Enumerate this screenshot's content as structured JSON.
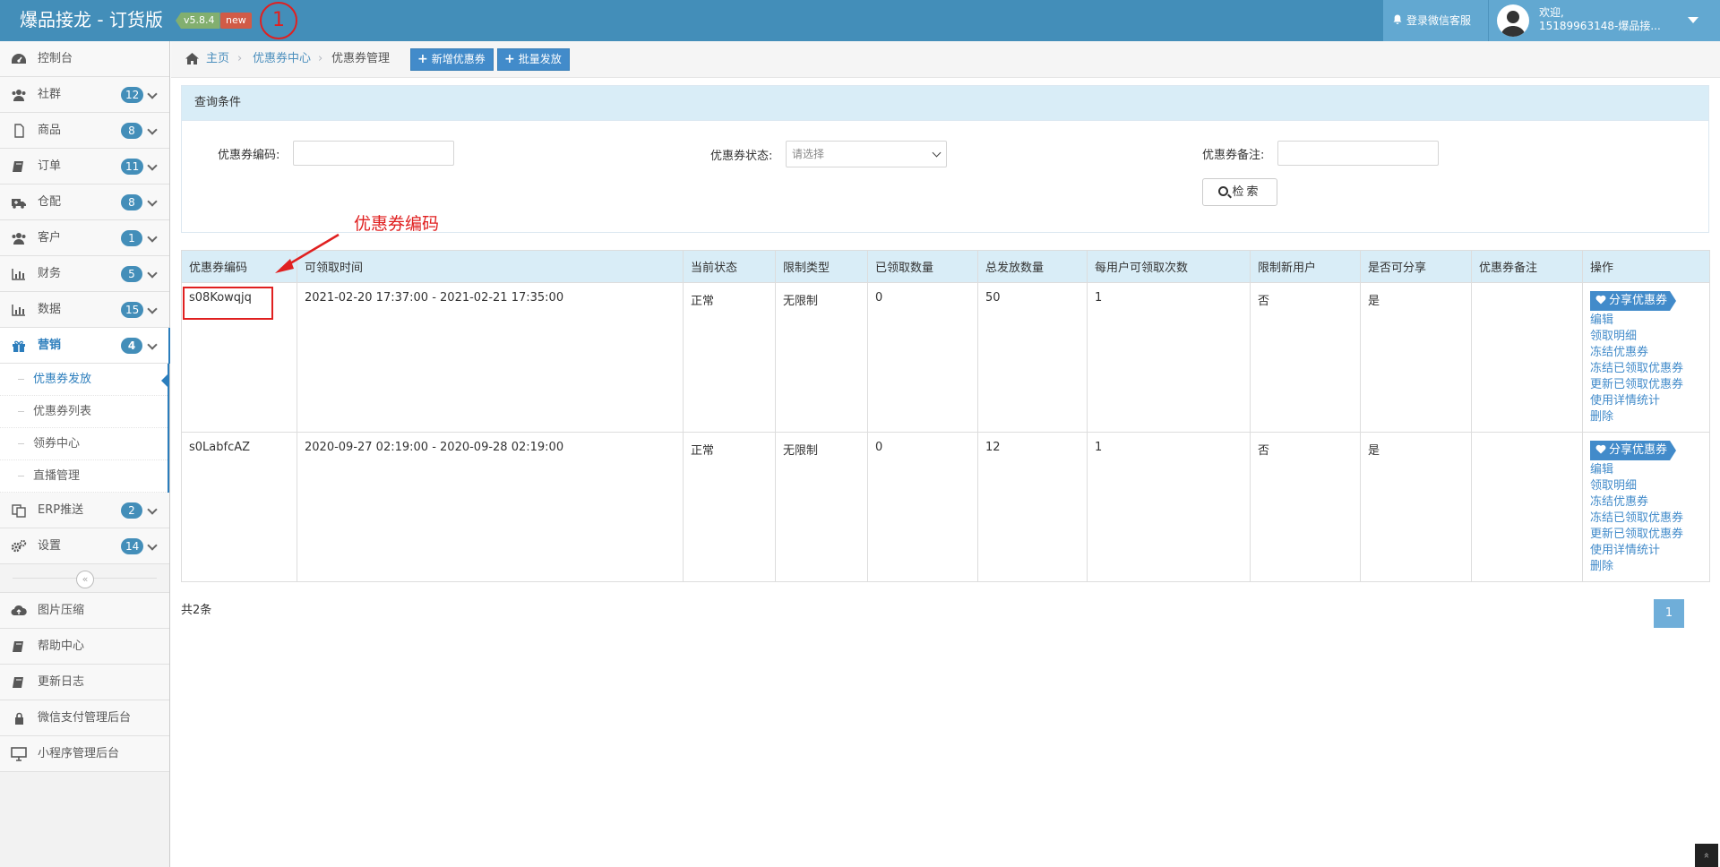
{
  "header": {
    "brand": "爆品接龙 - 订货版",
    "version": "v5.8.4",
    "new_badge": "new",
    "annotation_number": "1",
    "support_label": "登录微信客服",
    "welcome": "欢迎,",
    "user_name": "15189963148-爆品接..."
  },
  "sidebar": {
    "items": [
      {
        "label": "控制台",
        "icon": "dashboard-icon"
      },
      {
        "label": "社群",
        "count": "12",
        "icon": "users-icon"
      },
      {
        "label": "商品",
        "count": "8",
        "icon": "file-icon"
      },
      {
        "label": "订单",
        "count": "11",
        "icon": "book-icon"
      },
      {
        "label": "仓配",
        "count": "8",
        "icon": "ambulance-icon"
      },
      {
        "label": "客户",
        "count": "1",
        "icon": "users-icon"
      },
      {
        "label": "财务",
        "count": "5",
        "icon": "bar-chart-icon"
      },
      {
        "label": "数据",
        "count": "15",
        "icon": "bar-chart-icon"
      },
      {
        "label": "营销",
        "count": "4",
        "icon": "gift-icon"
      }
    ],
    "submenu": [
      "优惠券发放",
      "优惠券列表",
      "领券中心",
      "直播管理"
    ],
    "items2": [
      {
        "label": "ERP推送",
        "count": "2",
        "icon": "copy-icon"
      },
      {
        "label": "设置",
        "count": "14",
        "icon": "cogs-icon"
      }
    ],
    "collapse_glyph": "«",
    "items3": [
      {
        "label": "图片压缩",
        "icon": "cloud-upload-icon"
      },
      {
        "label": "帮助中心",
        "icon": "book-icon"
      },
      {
        "label": "更新日志",
        "icon": "book-icon"
      },
      {
        "label": "微信支付管理后台",
        "icon": "lock-icon"
      },
      {
        "label": "小程序管理后台",
        "icon": "desktop-icon"
      }
    ]
  },
  "breadcrumb": {
    "home": "主页",
    "sep": "›",
    "level1": "优惠券中心",
    "current": "优惠券管理"
  },
  "toolbar": {
    "add_coupon": "新增优惠券",
    "batch_issue": "批量发放"
  },
  "query": {
    "title": "查询条件",
    "code_label": "优惠券编码:",
    "code_value": "",
    "status_label": "优惠券状态:",
    "status_selected": "请选择",
    "remark_label": "优惠券备注:",
    "remark_value": "",
    "search_button": "检索"
  },
  "annotation": {
    "label": "优惠券编码"
  },
  "table": {
    "columns": [
      "优惠券编码",
      "可领取时间",
      "当前状态",
      "限制类型",
      "已领取数量",
      "总发放数量",
      "每用户可领取次数",
      "限制新用户",
      "是否可分享",
      "优惠券备注",
      "操作"
    ],
    "rows": [
      {
        "code": "s08Kowqjq",
        "time": "2021-02-20 17:37:00 - 2021-02-21 17:35:00",
        "status": "正常",
        "limit_type": "无限制",
        "claimed": "0",
        "total": "50",
        "per_user": "1",
        "new_user_only": "否",
        "shareable": "是",
        "remark": ""
      },
      {
        "code": "s0LabfcAZ",
        "time": "2020-09-27 02:19:00 - 2020-09-28 02:19:00",
        "status": "正常",
        "limit_type": "无限制",
        "claimed": "0",
        "total": "12",
        "per_user": "1",
        "new_user_only": "否",
        "shareable": "是",
        "remark": ""
      }
    ],
    "actions": {
      "share": "分享优惠券",
      "links": [
        "编辑",
        "领取明细",
        "冻结优惠券",
        "冻结已领取优惠券",
        "更新已领取优惠券",
        "使用详情统计",
        "删除"
      ]
    }
  },
  "footer": {
    "total": "共2条",
    "page": "1",
    "scroll_top_glyph": "»"
  },
  "colors": {
    "navbar": "#438eb9",
    "accent": "#428bca",
    "panel_header": "#d9edf7",
    "annotation": "#e02020"
  }
}
